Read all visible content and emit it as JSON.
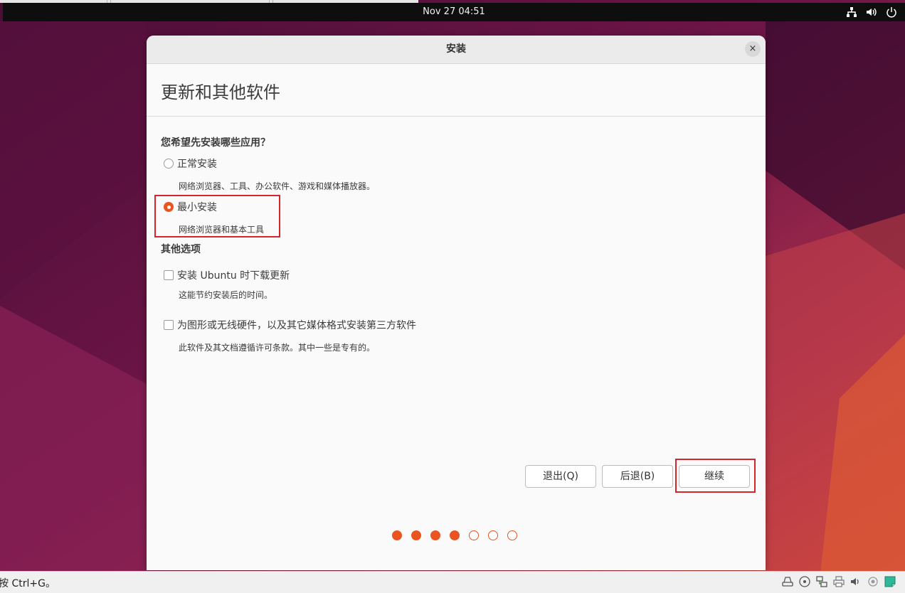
{
  "topbar": {
    "datetime": "Nov 27  04:51"
  },
  "dialog": {
    "title": "安装",
    "close_label": "×",
    "page_title": "更新和其他软件",
    "question": "您希望先安装哪些应用？",
    "install_options": [
      {
        "label": "正常安装",
        "description": "网络浏览器、工具、办公软件、游戏和媒体播放器。",
        "selected": false
      },
      {
        "label": "最小安装",
        "description": "网络浏览器和基本工具",
        "selected": true
      }
    ],
    "other_options_label": "其他选项",
    "other_options": [
      {
        "label": "安装 Ubuntu 时下载更新",
        "description": "这能节约安装后的时间。",
        "checked": false
      },
      {
        "label": "为图形或无线硬件，以及其它媒体格式安装第三方软件",
        "description": "此软件及其文档遵循许可条款。其中一些是专有的。",
        "checked": false
      }
    ],
    "buttons": {
      "quit": "退出(Q)",
      "back": "后退(B)",
      "continue": "继续"
    },
    "progress": {
      "completed_steps": 4,
      "total_steps": 7
    }
  },
  "statusbar": {
    "hint": "按 Ctrl+G。"
  },
  "colors": {
    "accent": "#e95420",
    "highlight_box": "#d6252a",
    "topbar": "#0e0e0e"
  },
  "icons": {
    "tray": [
      "network-icon",
      "volume-icon",
      "power-icon"
    ],
    "status": [
      "hard-disk-icon",
      "optical-drive-icon",
      "network-adapter-icon",
      "printer-icon",
      "audio-icon",
      "usb-icon",
      "notes-icon"
    ]
  }
}
